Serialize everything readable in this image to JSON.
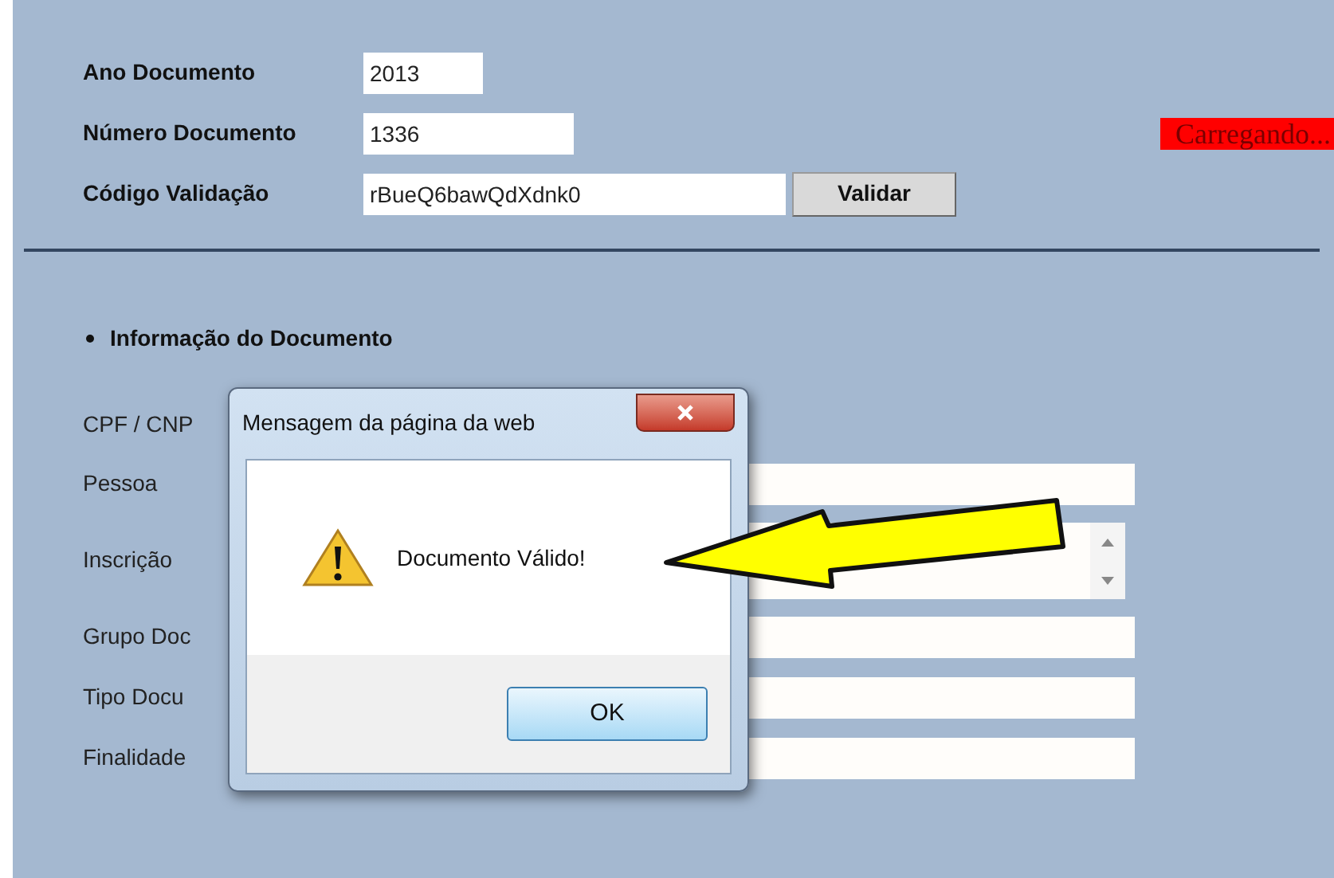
{
  "form": {
    "fields": [
      {
        "label": "Ano Documento",
        "value": "2013"
      },
      {
        "label": "Número Documento",
        "value": "1336"
      },
      {
        "label": "Código Validação",
        "value": "rBueQ6bawQdXdnk0"
      }
    ],
    "validate_button": "Validar",
    "loading_indicator": "Carregando..."
  },
  "section": {
    "title": "Informação do Documento",
    "rows": [
      {
        "label": "CPF / CNP",
        "kind": "none"
      },
      {
        "label": "Pessoa",
        "kind": "text"
      },
      {
        "label": "Inscrição",
        "kind": "textarea"
      },
      {
        "label": "Grupo Doc",
        "kind": "text"
      },
      {
        "label": "Tipo Docu",
        "kind": "text"
      },
      {
        "label": "Finalidade",
        "kind": "text"
      }
    ]
  },
  "dialog": {
    "title": "Mensagem da página da web",
    "message": "Documento Válido!",
    "ok_button": "OK"
  }
}
